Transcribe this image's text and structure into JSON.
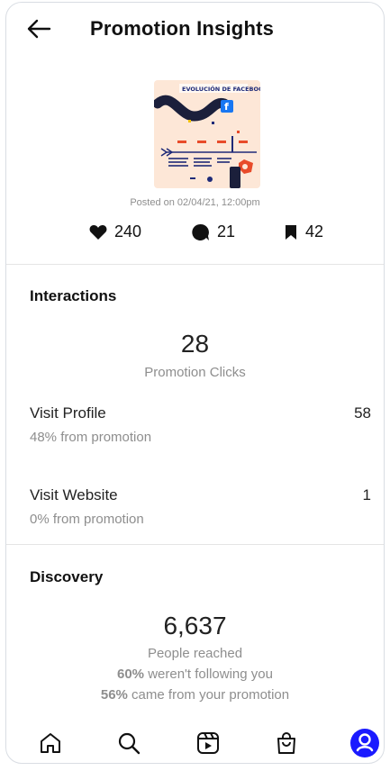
{
  "header": {
    "title": "Promotion Insights",
    "back_icon": "arrow-left-icon"
  },
  "post": {
    "posted_text": "Posted on 02/04/21, 12:00pm",
    "thumbnail_title": "EVOLUCIÓN DE FACEBOOK",
    "likes": "240",
    "comments": "21",
    "saves": "42"
  },
  "interactions": {
    "title": "Interactions",
    "promotion_clicks_value": "28",
    "promotion_clicks_label": "Promotion Clicks",
    "rows": [
      {
        "label": "Visit Profile",
        "sub": "48% from promotion",
        "value": "58"
      },
      {
        "label": "Visit Website",
        "sub": "0% from promotion",
        "value": "1"
      }
    ]
  },
  "discovery": {
    "title": "Discovery",
    "reached_value": "6,637",
    "reached_label": "People reached",
    "not_following_pct": "60%",
    "not_following_text": " weren't following you",
    "from_promotion_pct": "56%",
    "from_promotion_text": " came from your promotion"
  },
  "nav": {
    "items": [
      "home-icon",
      "search-icon",
      "reels-icon",
      "shop-icon",
      "profile-icon"
    ],
    "active_color": "#1a1aff"
  }
}
